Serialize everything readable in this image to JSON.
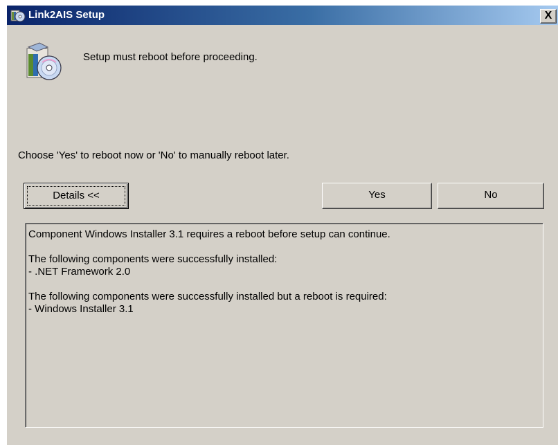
{
  "window": {
    "title": "Link2AIS Setup",
    "close_label": "X"
  },
  "message": {
    "main": "Setup must reboot before proceeding.",
    "prompt": "Choose 'Yes' to reboot now or 'No' to manually reboot later."
  },
  "buttons": {
    "details": "Details <<",
    "yes": "Yes",
    "no": "No"
  },
  "details": {
    "line1": "Component Windows Installer 3.1 requires a reboot before setup can continue.",
    "line2": "The following components were successfully installed:",
    "line3": "- .NET Framework 2.0",
    "line4": "The following components were successfully installed but a reboot is required:",
    "line5": "- Windows Installer 3.1"
  },
  "icons": {
    "title": "setup-cd-icon",
    "main": "setup-cd-icon"
  },
  "colors": {
    "face": "#d4d0c8",
    "titlebar_start": "#0a246a",
    "titlebar_end": "#a6caf0"
  }
}
